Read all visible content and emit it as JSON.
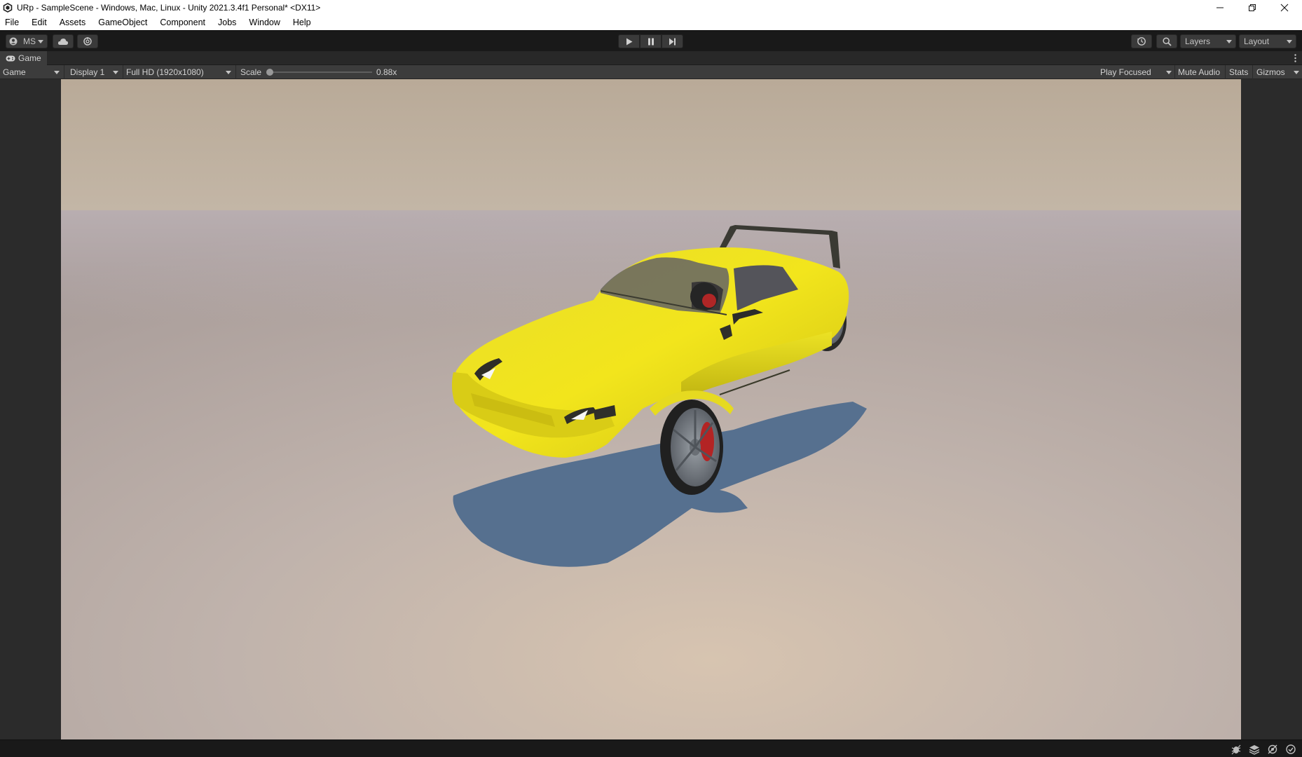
{
  "window": {
    "title": "URp - SampleScene - Windows, Mac, Linux - Unity 2021.3.4f1 Personal* <DX11>",
    "controls": [
      "minimize-icon",
      "restore-icon",
      "close-icon"
    ]
  },
  "menu": {
    "items": [
      "File",
      "Edit",
      "Assets",
      "GameObject",
      "Component",
      "Jobs",
      "Window",
      "Help"
    ]
  },
  "toolbar": {
    "account_label": "MS",
    "cloud_icon": "cloud-icon",
    "collab_icon": "collab-icon",
    "play_icon": "play-icon",
    "pause_icon": "pause-icon",
    "step_icon": "step-icon",
    "history_icon": "history-icon",
    "search_icon": "search-icon",
    "layers_label": "Layers",
    "layout_label": "Layout"
  },
  "game_tab": {
    "label": "Game",
    "icon": "gamepad-icon"
  },
  "game_controls": {
    "mode": "Game",
    "display": "Display 1",
    "resolution": "Full HD (1920x1080)",
    "scale_label": "Scale",
    "scale_value": "0.88x",
    "scale_fraction": 0.0,
    "play_focused": "Play Focused",
    "mute_audio": "Mute Audio",
    "stats": "Stats",
    "gizmos": "Gizmos"
  },
  "scene": {
    "object": "yellow sports car",
    "sky_color": "#bfb1a0",
    "ground_color": "#b9aeaa",
    "car_color": "#f0e020",
    "shadow_color": "#55708f"
  },
  "statusbar": {
    "icons": [
      "bug-icon",
      "layers-stack-icon",
      "debug-off-icon",
      "check-circle-icon"
    ]
  }
}
